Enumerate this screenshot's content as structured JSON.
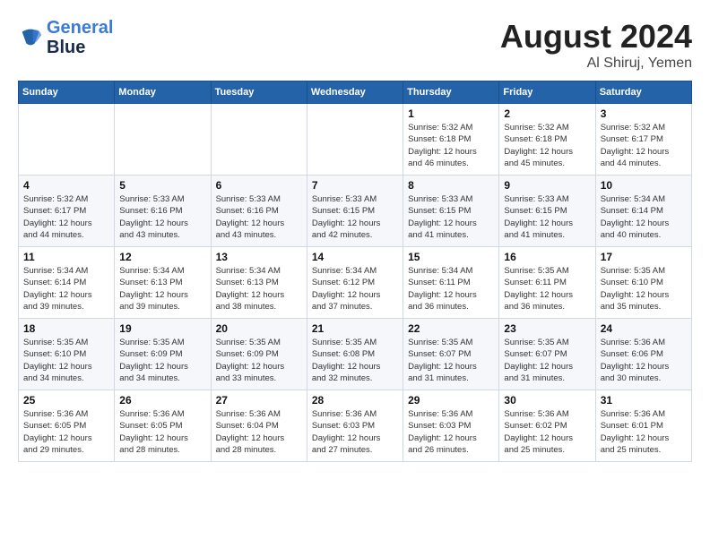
{
  "header": {
    "logo_line1": "General",
    "logo_line2": "Blue",
    "main_title": "August 2024",
    "subtitle": "Al Shiruj, Yemen"
  },
  "days_of_week": [
    "Sunday",
    "Monday",
    "Tuesday",
    "Wednesday",
    "Thursday",
    "Friday",
    "Saturday"
  ],
  "weeks": [
    [
      {
        "num": "",
        "info": ""
      },
      {
        "num": "",
        "info": ""
      },
      {
        "num": "",
        "info": ""
      },
      {
        "num": "",
        "info": ""
      },
      {
        "num": "1",
        "info": "Sunrise: 5:32 AM\nSunset: 6:18 PM\nDaylight: 12 hours\nand 46 minutes."
      },
      {
        "num": "2",
        "info": "Sunrise: 5:32 AM\nSunset: 6:18 PM\nDaylight: 12 hours\nand 45 minutes."
      },
      {
        "num": "3",
        "info": "Sunrise: 5:32 AM\nSunset: 6:17 PM\nDaylight: 12 hours\nand 44 minutes."
      }
    ],
    [
      {
        "num": "4",
        "info": "Sunrise: 5:32 AM\nSunset: 6:17 PM\nDaylight: 12 hours\nand 44 minutes."
      },
      {
        "num": "5",
        "info": "Sunrise: 5:33 AM\nSunset: 6:16 PM\nDaylight: 12 hours\nand 43 minutes."
      },
      {
        "num": "6",
        "info": "Sunrise: 5:33 AM\nSunset: 6:16 PM\nDaylight: 12 hours\nand 43 minutes."
      },
      {
        "num": "7",
        "info": "Sunrise: 5:33 AM\nSunset: 6:15 PM\nDaylight: 12 hours\nand 42 minutes."
      },
      {
        "num": "8",
        "info": "Sunrise: 5:33 AM\nSunset: 6:15 PM\nDaylight: 12 hours\nand 41 minutes."
      },
      {
        "num": "9",
        "info": "Sunrise: 5:33 AM\nSunset: 6:15 PM\nDaylight: 12 hours\nand 41 minutes."
      },
      {
        "num": "10",
        "info": "Sunrise: 5:34 AM\nSunset: 6:14 PM\nDaylight: 12 hours\nand 40 minutes."
      }
    ],
    [
      {
        "num": "11",
        "info": "Sunrise: 5:34 AM\nSunset: 6:14 PM\nDaylight: 12 hours\nand 39 minutes."
      },
      {
        "num": "12",
        "info": "Sunrise: 5:34 AM\nSunset: 6:13 PM\nDaylight: 12 hours\nand 39 minutes."
      },
      {
        "num": "13",
        "info": "Sunrise: 5:34 AM\nSunset: 6:13 PM\nDaylight: 12 hours\nand 38 minutes."
      },
      {
        "num": "14",
        "info": "Sunrise: 5:34 AM\nSunset: 6:12 PM\nDaylight: 12 hours\nand 37 minutes."
      },
      {
        "num": "15",
        "info": "Sunrise: 5:34 AM\nSunset: 6:11 PM\nDaylight: 12 hours\nand 36 minutes."
      },
      {
        "num": "16",
        "info": "Sunrise: 5:35 AM\nSunset: 6:11 PM\nDaylight: 12 hours\nand 36 minutes."
      },
      {
        "num": "17",
        "info": "Sunrise: 5:35 AM\nSunset: 6:10 PM\nDaylight: 12 hours\nand 35 minutes."
      }
    ],
    [
      {
        "num": "18",
        "info": "Sunrise: 5:35 AM\nSunset: 6:10 PM\nDaylight: 12 hours\nand 34 minutes."
      },
      {
        "num": "19",
        "info": "Sunrise: 5:35 AM\nSunset: 6:09 PM\nDaylight: 12 hours\nand 34 minutes."
      },
      {
        "num": "20",
        "info": "Sunrise: 5:35 AM\nSunset: 6:09 PM\nDaylight: 12 hours\nand 33 minutes."
      },
      {
        "num": "21",
        "info": "Sunrise: 5:35 AM\nSunset: 6:08 PM\nDaylight: 12 hours\nand 32 minutes."
      },
      {
        "num": "22",
        "info": "Sunrise: 5:35 AM\nSunset: 6:07 PM\nDaylight: 12 hours\nand 31 minutes."
      },
      {
        "num": "23",
        "info": "Sunrise: 5:35 AM\nSunset: 6:07 PM\nDaylight: 12 hours\nand 31 minutes."
      },
      {
        "num": "24",
        "info": "Sunrise: 5:36 AM\nSunset: 6:06 PM\nDaylight: 12 hours\nand 30 minutes."
      }
    ],
    [
      {
        "num": "25",
        "info": "Sunrise: 5:36 AM\nSunset: 6:05 PM\nDaylight: 12 hours\nand 29 minutes."
      },
      {
        "num": "26",
        "info": "Sunrise: 5:36 AM\nSunset: 6:05 PM\nDaylight: 12 hours\nand 28 minutes."
      },
      {
        "num": "27",
        "info": "Sunrise: 5:36 AM\nSunset: 6:04 PM\nDaylight: 12 hours\nand 28 minutes."
      },
      {
        "num": "28",
        "info": "Sunrise: 5:36 AM\nSunset: 6:03 PM\nDaylight: 12 hours\nand 27 minutes."
      },
      {
        "num": "29",
        "info": "Sunrise: 5:36 AM\nSunset: 6:03 PM\nDaylight: 12 hours\nand 26 minutes."
      },
      {
        "num": "30",
        "info": "Sunrise: 5:36 AM\nSunset: 6:02 PM\nDaylight: 12 hours\nand 25 minutes."
      },
      {
        "num": "31",
        "info": "Sunrise: 5:36 AM\nSunset: 6:01 PM\nDaylight: 12 hours\nand 25 minutes."
      }
    ]
  ]
}
